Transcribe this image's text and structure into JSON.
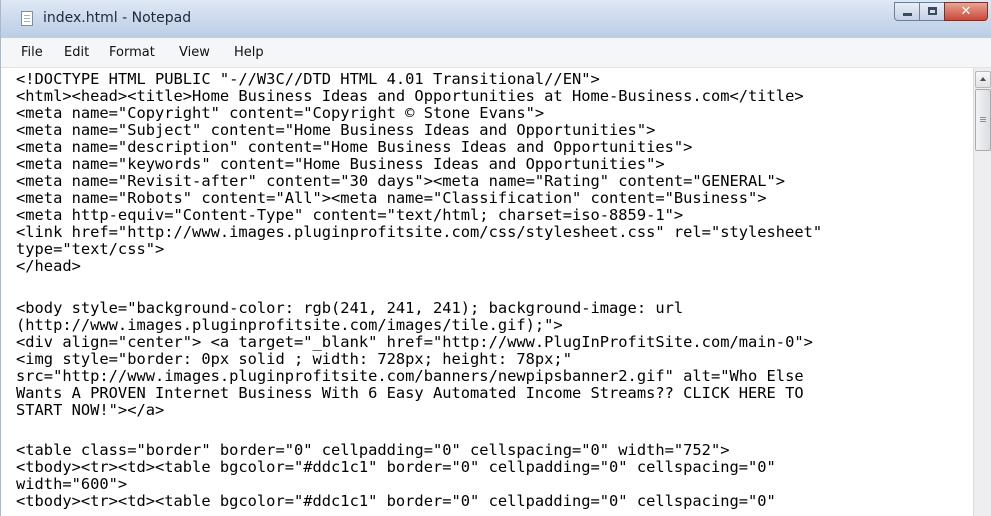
{
  "window": {
    "title": "index.html - Notepad",
    "close_glyph": "✕"
  },
  "menu": [
    "File",
    "Edit",
    "Format",
    "View",
    "Help"
  ],
  "editor": {
    "lines": [
      "<!DOCTYPE HTML PUBLIC \"-//W3C//DTD HTML 4.01 Transitional//EN\">",
      "<html><head><title>Home Business Ideas and Opportunities at Home-Business.com</title>",
      "<meta name=\"Copyright\" content=\"Copyright © Stone Evans\">",
      "<meta name=\"Subject\" content=\"Home Business Ideas and Opportunities\">",
      "<meta name=\"description\" content=\"Home Business Ideas and Opportunities\">",
      "<meta name=\"keywords\" content=\"Home Business Ideas and Opportunities\">",
      "<meta name=\"Revisit-after\" content=\"30 days\"><meta name=\"Rating\" content=\"GENERAL\">",
      "<meta name=\"Robots\" content=\"All\"><meta name=\"Classification\" content=\"Business\">",
      "<meta http-equiv=\"Content-Type\" content=\"text/html; charset=iso-8859-1\">",
      "<link href=\"http://www.images.pluginprofitsite.com/css/stylesheet.css\" rel=\"stylesheet\"",
      "type=\"text/css\">",
      "</head>",
      "",
      "<body style=\"background-color: rgb(241, 241, 241); background-image: url",
      "(http://www.images.pluginprofitsite.com/images/tile.gif);\">",
      "<div align=\"center\"> <a target=\"_blank\" href=\"http://www.PlugInProfitSite.com/main-0\">",
      "<img style=\"border: 0px solid ; width: 728px; height: 78px;\"",
      "src=\"http://www.images.pluginprofitsite.com/banners/newpipsbanner2.gif\" alt=\"Who Else",
      "Wants A PROVEN Internet Business With 6 Easy Automated Income Streams?? CLICK HERE TO",
      "START NOW!\"></a>",
      "",
      "<table class=\"border\" border=\"0\" cellpadding=\"0\" cellspacing=\"0\" width=\"752\">",
      "<tbody><tr><td><table bgcolor=\"#ddc1c1\" border=\"0\" cellpadding=\"0\" cellspacing=\"0\"",
      "width=\"600\">",
      "<tbody><tr><td><table bgcolor=\"#ddc1c1\" border=\"0\" cellpadding=\"0\" cellspacing=\"0\""
    ]
  },
  "icons": {
    "app": "notepad-icon",
    "minimize": "minimize-icon",
    "maximize": "maximize-icon",
    "close": "close-icon",
    "scroll_up": "scroll-up-arrow-icon"
  },
  "colors": {
    "titlebar": "#c9d8ec",
    "close_button": "#c8493a",
    "menubar": "#f5f6f7",
    "editor_bg": "#ffffff"
  }
}
